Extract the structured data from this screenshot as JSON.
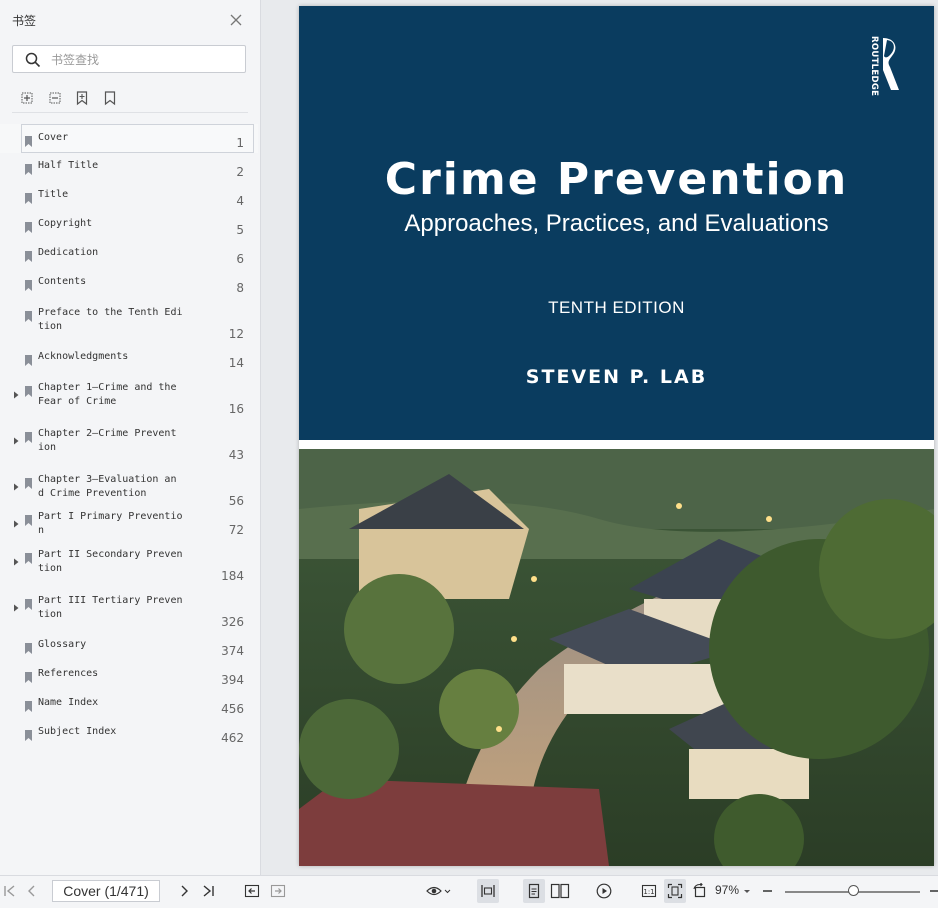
{
  "sidebar": {
    "title": "书签",
    "search_placeholder": "书签查找",
    "bookmarks": [
      {
        "label": "Cover",
        "page": "1",
        "expandable": false,
        "selected": true
      },
      {
        "label": "Half Title",
        "page": "2",
        "expandable": false
      },
      {
        "label": "Title",
        "page": "4",
        "expandable": false
      },
      {
        "label": "Copyright",
        "page": "5",
        "expandable": false
      },
      {
        "label": "Dedication",
        "page": "6",
        "expandable": false
      },
      {
        "label": "Contents",
        "page": "8",
        "expandable": false
      },
      {
        "label": "Preface to the Tenth Edi\ntion",
        "page": "12",
        "expandable": false
      },
      {
        "label": "Acknowledgments",
        "page": "14",
        "expandable": false
      },
      {
        "label": "Chapter 1—Crime and the\nFear of Crime",
        "page": "16",
        "expandable": true
      },
      {
        "label": "Chapter 2—Crime Prevent\nion",
        "page": "43",
        "expandable": true
      },
      {
        "label": "Chapter 3—Evaluation an\nd Crime Prevention",
        "page": "56",
        "expandable": true
      },
      {
        "label": "Part I Primary Preventio\nn",
        "page": "72",
        "expandable": true
      },
      {
        "label": "Part II Secondary Preven\ntion",
        "page": "184",
        "expandable": true
      },
      {
        "label": "Part III Tertiary Preven\ntion",
        "page": "326",
        "expandable": true
      },
      {
        "label": "Glossary",
        "page": "374",
        "expandable": false
      },
      {
        "label": "References",
        "page": "394",
        "expandable": false
      },
      {
        "label": "Name Index",
        "page": "456",
        "expandable": false
      },
      {
        "label": "Subject Index",
        "page": "462",
        "expandable": false
      }
    ]
  },
  "cover": {
    "publisher": "ROUTLEDGE",
    "title": "Crime Prevention",
    "subtitle": "Approaches, Practices, and Evaluations",
    "edition": "TENTH EDITION",
    "author": "STEVEN P. LAB",
    "background_color": "#0a3c5f"
  },
  "bottombar": {
    "page_indicator": "Cover (1/471)",
    "zoom": "97%",
    "zoom_fraction": 0.5
  }
}
